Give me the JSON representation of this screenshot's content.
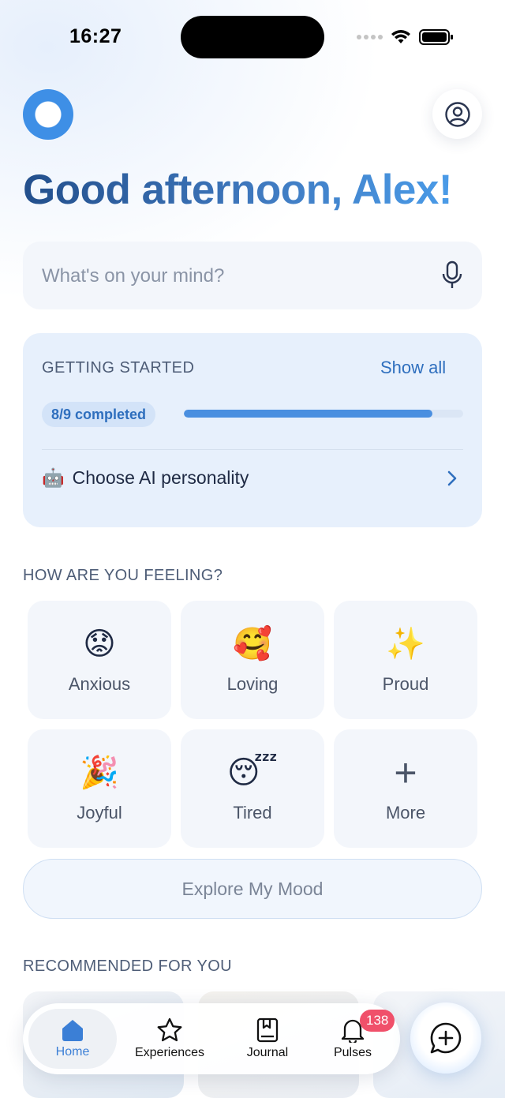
{
  "status": {
    "time": "16:27"
  },
  "header": {
    "greeting": "Good afternoon, Alex!"
  },
  "search": {
    "placeholder": "What's on your mind?"
  },
  "getting_started": {
    "title": "GETTING STARTED",
    "show_all": "Show all",
    "progress_text": "8/9 completed",
    "progress_fraction": 0.89,
    "task_emoji": "🤖",
    "task_label": "Choose AI personality"
  },
  "feelings": {
    "title": "HOW ARE YOU FEELING?",
    "moods": [
      {
        "emoji": "😟",
        "label": "Anxious"
      },
      {
        "emoji": "🥰",
        "label": "Loving"
      },
      {
        "emoji": "✨",
        "label": "Proud"
      },
      {
        "emoji": "🎉",
        "label": "Joyful"
      },
      {
        "emoji": "😴",
        "label": "Tired"
      },
      {
        "emoji": "+",
        "label": "More"
      }
    ],
    "explore_label": "Explore My Mood"
  },
  "recommended": {
    "title": "RECOMMENDED FOR YOU"
  },
  "tabbar": {
    "tabs": [
      {
        "label": "Home",
        "icon": "home-icon"
      },
      {
        "label": "Experiences",
        "icon": "star-icon"
      },
      {
        "label": "Journal",
        "icon": "journal-icon"
      },
      {
        "label": "Pulses",
        "icon": "bell-icon"
      }
    ],
    "badge": "138"
  },
  "colors": {
    "accent": "#3b7fd6",
    "badge": "#f0506a",
    "progress": "#4a8fe0"
  }
}
